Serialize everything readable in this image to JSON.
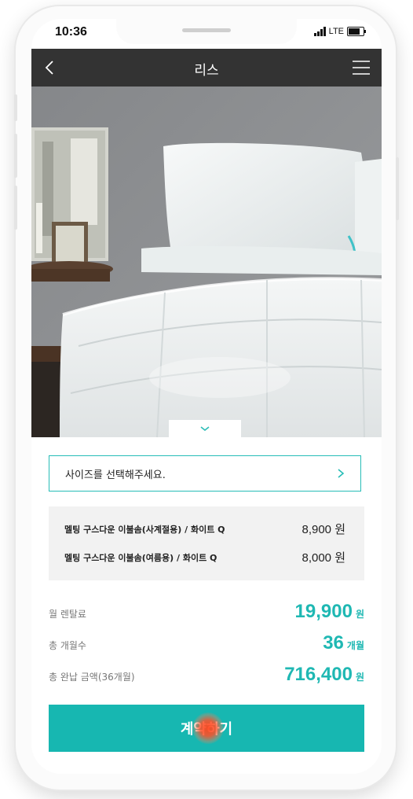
{
  "status_bar": {
    "time": "10:36",
    "network": "LTE"
  },
  "header": {
    "title": "리스"
  },
  "size_select": {
    "placeholder": "사이즈를 선택해주세요."
  },
  "options": [
    {
      "name": "멜팅 구스다운 이불솜(사계절용) / 화이트 Q",
      "price": "8,900 원"
    },
    {
      "name": "멜팅 구스다운 이불솜(여름용) / 화이트 Q",
      "price": "8,000 원"
    }
  ],
  "summary": {
    "monthly_fee": {
      "label": "월 렌탈료",
      "value": "19,900",
      "unit": "원"
    },
    "months": {
      "label": "총 개월수",
      "value": "36",
      "unit": "개월"
    },
    "total": {
      "label": "총 완납 금액(36개월)",
      "value": "716,400",
      "unit": "원"
    }
  },
  "cta": {
    "label": "계약하기"
  },
  "colors": {
    "accent": "#17b7b1",
    "topbar": "#333333"
  },
  "icons": [
    "back-icon",
    "menu-icon",
    "chevron-down-icon",
    "chevron-right-icon"
  ]
}
